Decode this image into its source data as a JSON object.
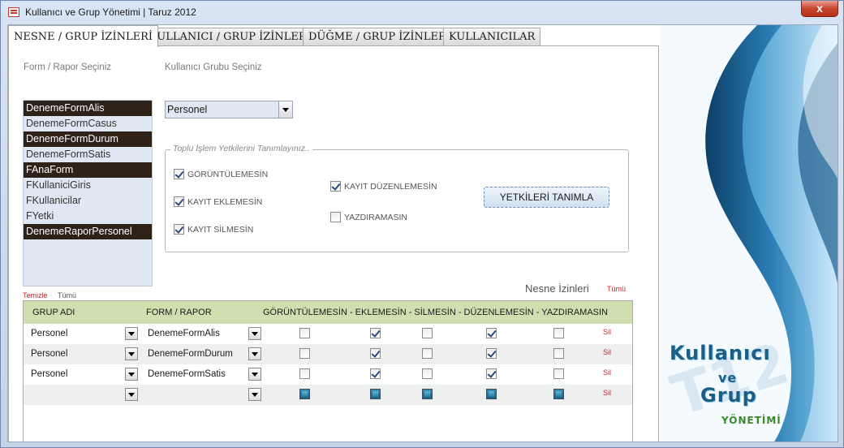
{
  "window": {
    "title": "Kullanıcı ve Grup Yönetimi | Taruz 2012",
    "close_label": "x"
  },
  "tabs": [
    {
      "label": "NESNE / GRUP İZİNLERİ",
      "active": true
    },
    {
      "label": "KULLANICI / GRUP İZİNLERİ",
      "active": false
    },
    {
      "label": "DÜĞME / GRUP İZİNLERİ",
      "active": false
    },
    {
      "label": "KULLANICILAR",
      "active": false
    }
  ],
  "forms": {
    "label": "Form / Rapor Seçiniz",
    "items": [
      {
        "name": "DenemeFormAlis",
        "selected": true
      },
      {
        "name": "DenemeFormCasus",
        "selected": false
      },
      {
        "name": "DenemeFormDurum",
        "selected": true
      },
      {
        "name": "DenemeFormSatis",
        "selected": false
      },
      {
        "name": "FAnaForm",
        "selected": true
      },
      {
        "name": "FKullaniciGiris",
        "selected": false
      },
      {
        "name": "FKullanicilar",
        "selected": false
      },
      {
        "name": "FYetki",
        "selected": false
      },
      {
        "name": "DenemeRaporPersonel",
        "selected": true
      }
    ],
    "clear_label": "Temizle",
    "all_label": "Tümü"
  },
  "group": {
    "label": "Kullanıcı Grubu Seçiniz",
    "value": "Personel"
  },
  "bulk": {
    "legend": "Toplu İşlem Yetkilerini Tanımlayınız..",
    "options": {
      "goruntulemesin": {
        "label": "GÖRÜNTÜLEMESİN",
        "checked": true
      },
      "kayit_eklemesin": {
        "label": "KAYIT EKLEMESİN",
        "checked": true
      },
      "kayit_silmesin": {
        "label": "KAYIT SİLMESİN",
        "checked": true
      },
      "kayit_duzenlemesin": {
        "label": "KAYIT DÜZENLEMESİN",
        "checked": true
      },
      "yazdiramasin": {
        "label": "YAZDIRAMASIN",
        "checked": false
      }
    },
    "button_label": "YETKİLERİ TANIMLA"
  },
  "permissions": {
    "title": "Nesne İzinleri",
    "all_label": "Tümü",
    "headers": {
      "group": "GRUP ADI",
      "form": "FORM / RAPOR",
      "flags": "GÖRÜNTÜLEMESİN - EKLEMESİN - SİLMESİN - DÜZENLEMESİN - YAZDIRAMASIN"
    },
    "rows": [
      {
        "group": "Personel",
        "form": "DenemeFormAlis",
        "flags": [
          false,
          true,
          false,
          true,
          false
        ],
        "delete_label": "Sil"
      },
      {
        "group": "Personel",
        "form": "DenemeFormDurum",
        "flags": [
          false,
          true,
          false,
          true,
          false
        ],
        "delete_label": "Sil"
      },
      {
        "group": "Personel",
        "form": "DenemeFormSatis",
        "flags": [
          false,
          true,
          false,
          true,
          false
        ],
        "delete_label": "Sil"
      },
      {
        "group": "",
        "form": "",
        "flags": [
          null,
          null,
          null,
          null,
          null
        ],
        "delete_label": "Sil"
      }
    ]
  },
  "logo": {
    "line1": "Kullanıcı",
    "line2": "ve",
    "line3": "Grup",
    "line4": "YÖNETİMİ"
  }
}
